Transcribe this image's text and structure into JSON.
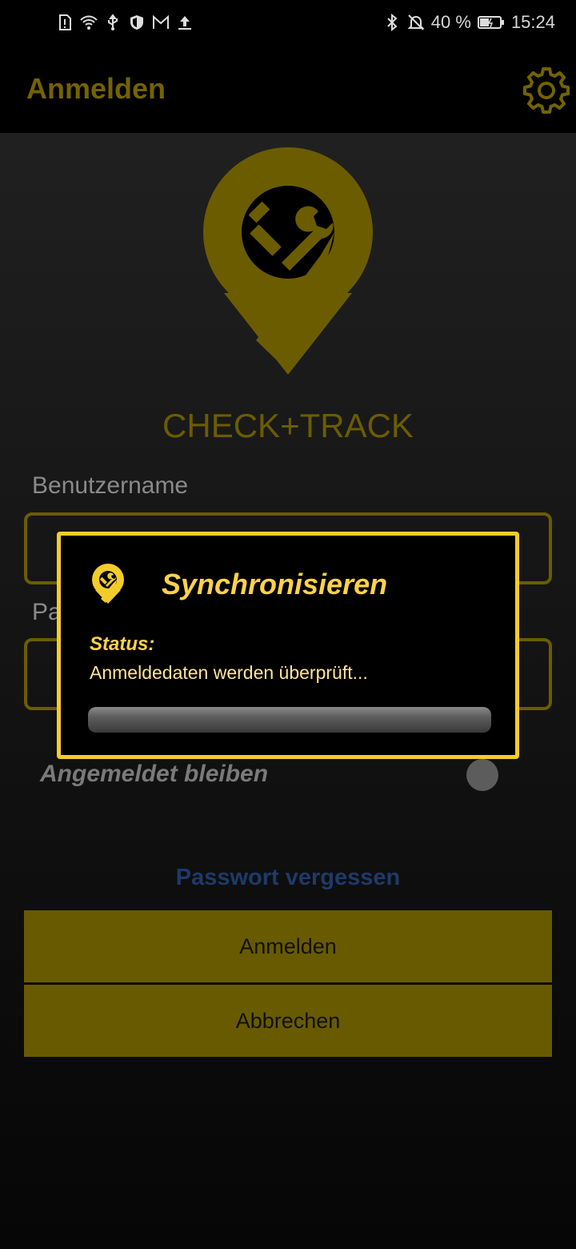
{
  "status_bar": {
    "left_icons": [
      "sim-alert-icon",
      "wifi-icon",
      "usb-icon",
      "shield-icon",
      "mail-icon",
      "upload-icon"
    ],
    "right_icons": [
      "bluetooth-icon",
      "bell-off-icon",
      "battery-icon"
    ],
    "battery": "40 %",
    "time": "15:24"
  },
  "appbar": {
    "title": "Anmelden",
    "settings_icon": "gear-icon"
  },
  "login": {
    "brand": "CHECK+TRACK",
    "username_label": "Benutzername",
    "password_label": "Pa",
    "remember_label": "Angemeldet bleiben",
    "remember_on": false,
    "forgot_link": "Passwort vergessen",
    "login_button": "Anmelden",
    "cancel_button": "Abbrechen"
  },
  "dialog": {
    "title": "Synchronisieren",
    "status_label": "Status:",
    "status_text": "Anmeldedaten werden überprüft...",
    "progress": 0
  },
  "colors": {
    "accent_dark": "#6b5c00",
    "accent_bright": "#f3cc2b",
    "dialog_text": "#ffd24a",
    "link": "#1e3a6a"
  }
}
